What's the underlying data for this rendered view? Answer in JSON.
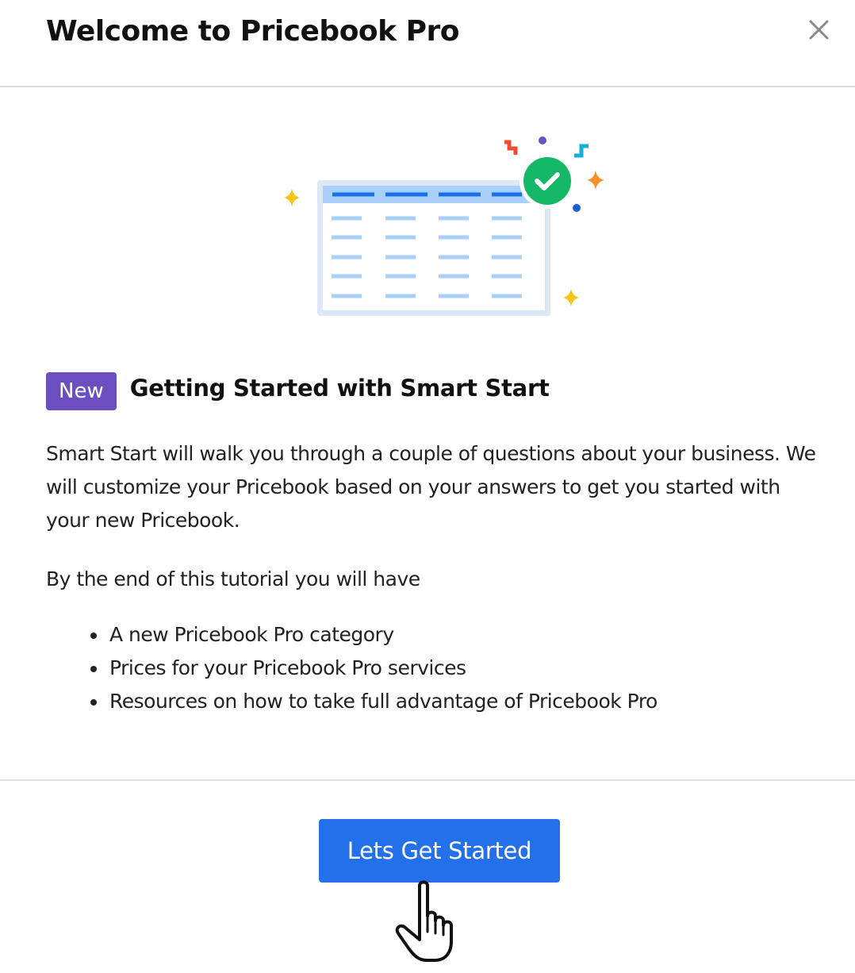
{
  "modal": {
    "title": "Welcome to Pricebook Pro",
    "close_icon": "close-icon"
  },
  "illustration": {
    "icon": "spreadsheet-success-illustration",
    "colors": {
      "table_frame": "#dce8f5",
      "table_header": "#a8d0fb",
      "header_dash": "#1b6fe8",
      "row_dash": "#a7d1f9",
      "check_circle": "#14b866",
      "sparkle_yellow": "#f5c518",
      "sparkle_orange": "#f7912f",
      "confetti_red": "#ef4d2f",
      "confetti_cyan": "#19aed9",
      "dot_purple": "#6b4fc0",
      "dot_blue": "#1a5fd6"
    }
  },
  "section": {
    "badge": "New",
    "title": "Getting Started with Smart Start",
    "intro": "Smart Start will walk you through a couple of questions about your business. We will customize your Pricebook based on your answers to get you started with your new Pricebook.",
    "lead": "By the end of this tutorial you will have",
    "benefits": [
      "A new Pricebook Pro category",
      "Prices for your Pricebook Pro services",
      "Resources on how to take full advantage of Pricebook Pro"
    ]
  },
  "footer": {
    "primary_button": "Lets Get Started"
  },
  "cursor": {
    "icon": "hand-pointer-icon"
  },
  "colors": {
    "badge": "#6b4fc0",
    "primary": "#2470eb",
    "divider": "#dedede",
    "text": "#222222"
  }
}
